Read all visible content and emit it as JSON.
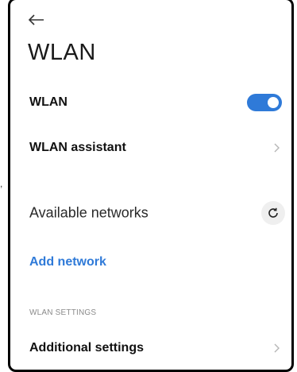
{
  "header": {
    "back_icon": "arrow-left-icon",
    "title": "WLAN"
  },
  "rows": {
    "wlan": {
      "label": "WLAN",
      "toggle_on": true,
      "toggle_color": "#2f7ad8"
    },
    "assistant": {
      "label": "WLAN assistant",
      "icon": "chevron-right-icon"
    },
    "available": {
      "label": "Available networks",
      "icon": "refresh-icon"
    },
    "add_network": {
      "label": "Add network",
      "color": "#2f7ad8"
    },
    "section_header": "WLAN SETTINGS",
    "additional": {
      "label": "Additional settings",
      "icon": "chevron-right-icon"
    }
  },
  "colors": {
    "accent": "#2f7ad8",
    "frame_border": "#000000",
    "muted_text": "#8a8a8a"
  }
}
